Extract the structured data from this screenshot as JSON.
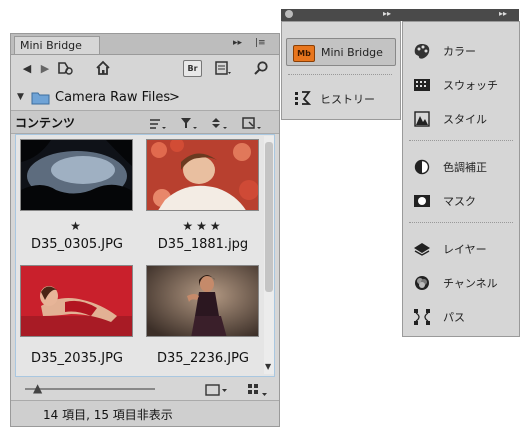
{
  "mini_bridge": {
    "tab_label": "Mini Bridge",
    "header_controls": "▸▸",
    "menu_glyph": "|≡",
    "path_label": "Camera Raw Files",
    "path_arrow": ">",
    "contents_label": "コンテンツ",
    "br_label": "Br",
    "thumbnails": [
      {
        "name": "D35_0305.JPG",
        "stars": "★"
      },
      {
        "name": "D35_1881.jpg",
        "stars": "★★★"
      },
      {
        "name": "D35_2035.JPG",
        "stars": ""
      },
      {
        "name": "D35_2236.JPG",
        "stars": ""
      }
    ],
    "status": "14 項目, 15 項目非表示",
    "zoom_level": 0.1
  },
  "dock": {
    "top_glyph": "▸▸",
    "buttons": [
      {
        "label": "Mini Bridge",
        "icon": "mb-logo-icon",
        "badge": "Mb"
      },
      {
        "label": "ヒストリー",
        "icon": "history-icon"
      }
    ]
  },
  "right_panel": {
    "top_glyph": "▸▸",
    "items": [
      {
        "label": "カラー",
        "icon": "palette-icon"
      },
      {
        "label": "スウォッチ",
        "icon": "swatch-grid-icon"
      },
      {
        "label": "スタイル",
        "icon": "style-icon"
      },
      {
        "label": "色調補正",
        "icon": "adjustment-icon"
      },
      {
        "label": "マスク",
        "icon": "mask-icon"
      },
      {
        "label": "レイヤー",
        "icon": "layers-icon"
      },
      {
        "label": "チャンネル",
        "icon": "channels-icon"
      },
      {
        "label": "パス",
        "icon": "paths-icon"
      }
    ]
  },
  "colors": {
    "panel_bg": "#d6d6d6",
    "dock_dark": "#4a4a4a",
    "selection_border": "#a9c7e0",
    "mb_badge": "#e8761e"
  }
}
